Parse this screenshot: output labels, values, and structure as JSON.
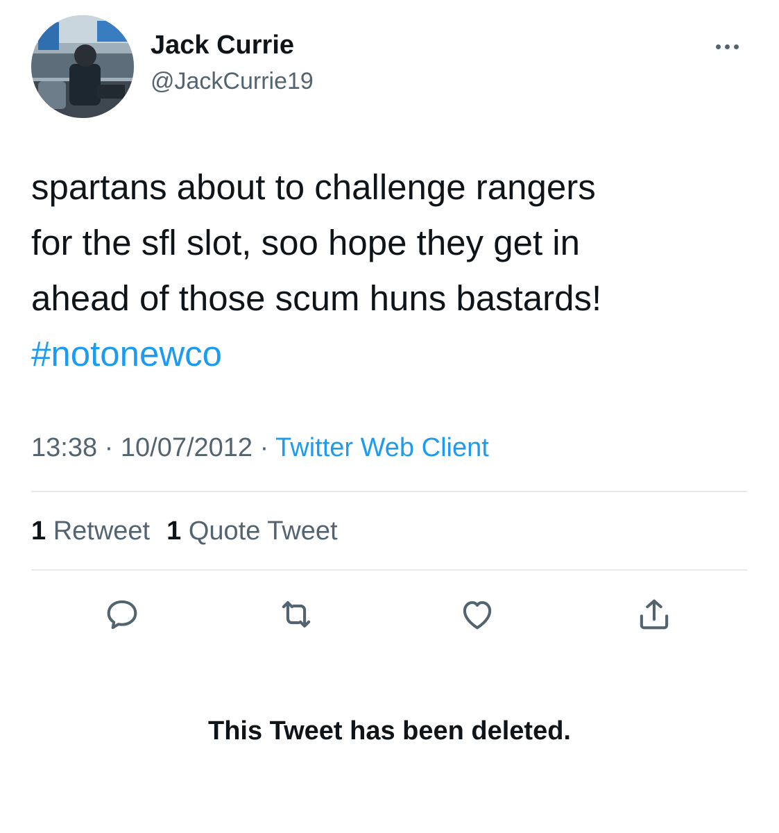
{
  "tweet": {
    "author": {
      "name": "Jack Currie",
      "handle": "@JackCurrie19"
    },
    "text_lines": [
      "spartans about to challenge rangers",
      "for the sfl slot, soo hope they get in",
      "ahead of those scum huns bastards!"
    ],
    "hashtag": "#notonewco",
    "meta": {
      "time": "13:38",
      "separator": " · ",
      "date": "10/07/2012",
      "source": "Twitter Web Client"
    },
    "stats": {
      "retweet_count": "1",
      "retweet_label": "Retweet",
      "quote_count": "1",
      "quote_label": "Quote Tweet"
    },
    "actions": [
      "reply-icon",
      "retweet-icon",
      "like-icon",
      "share-icon"
    ]
  },
  "notice": {
    "deleted": "This Tweet has been deleted."
  },
  "colors": {
    "link": "#1d9bf0",
    "secondary_text": "#536471",
    "primary_text": "#0f1419",
    "divider": "#e6e9ec"
  }
}
